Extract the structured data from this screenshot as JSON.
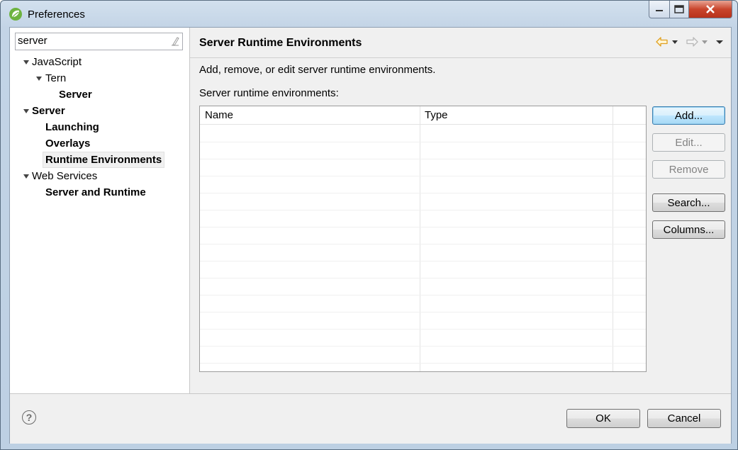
{
  "window": {
    "title": "Preferences"
  },
  "filter": {
    "value": "server"
  },
  "tree": {
    "items": [
      {
        "label": "JavaScript"
      },
      {
        "label": "Tern"
      },
      {
        "label": "Server"
      },
      {
        "label": "Server"
      },
      {
        "label": "Launching"
      },
      {
        "label": "Overlays"
      },
      {
        "label": "Runtime Environments"
      },
      {
        "label": "Web Services"
      },
      {
        "label": "Server and Runtime"
      }
    ]
  },
  "page": {
    "title": "Server Runtime Environments",
    "description": "Add, remove, or edit server runtime environments.",
    "list_label": "Server runtime environments:"
  },
  "table": {
    "columns": [
      "Name",
      "Type"
    ],
    "rows": []
  },
  "buttons": {
    "add": "Add...",
    "edit": "Edit...",
    "remove": "Remove",
    "search": "Search...",
    "columns": "Columns..."
  },
  "dialog": {
    "ok": "OK",
    "cancel": "Cancel",
    "help": "?"
  },
  "colors": {
    "nav_back_arrow": "#e0a020",
    "nav_forward_arrow": "#b8b8b8"
  }
}
